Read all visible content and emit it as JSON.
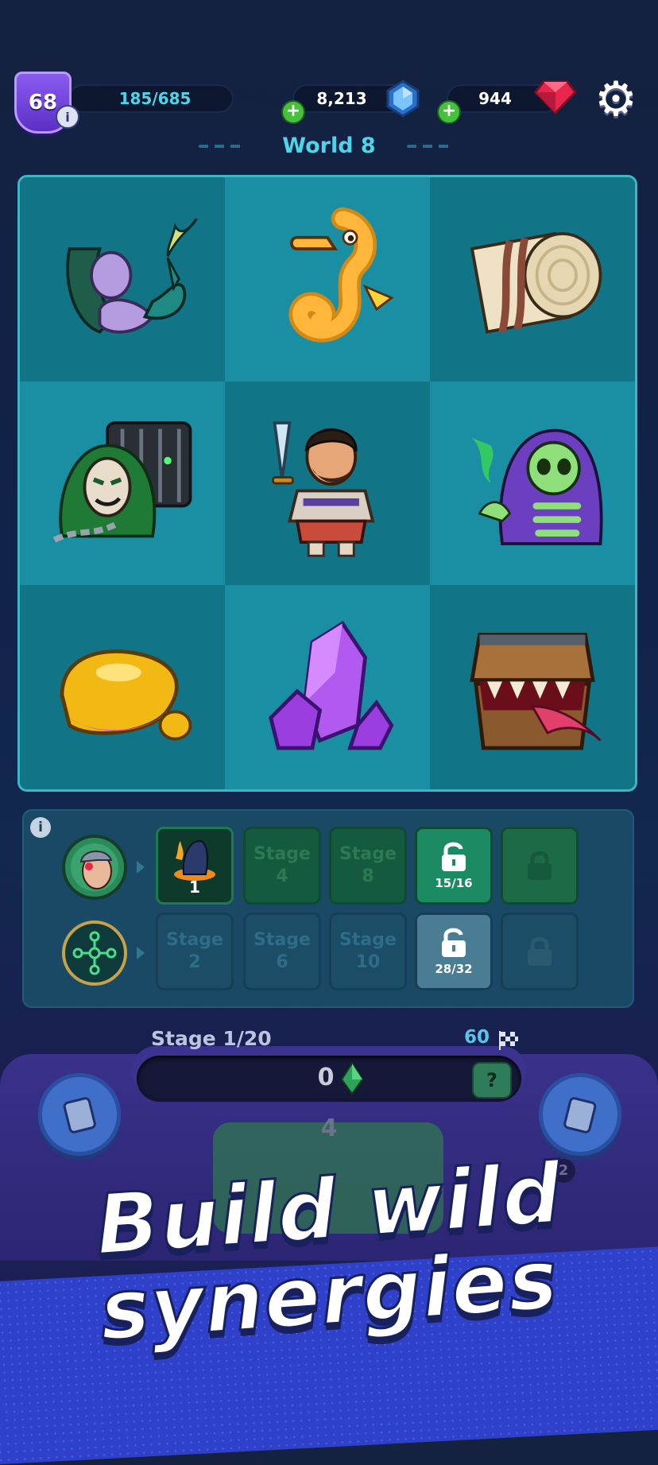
{
  "hud": {
    "level": "68",
    "level_info_icon": "i",
    "xp": "185/685",
    "crystals": "8,213",
    "gems": "944",
    "add_symbol": "+"
  },
  "world": {
    "title": "World 8"
  },
  "grid": {
    "items": [
      {
        "name": "mermaid"
      },
      {
        "name": "seahorse"
      },
      {
        "name": "scroll"
      },
      {
        "name": "caged-masked-wraith"
      },
      {
        "name": "warrior-hero"
      },
      {
        "name": "hooded-skeleton"
      },
      {
        "name": "gold-nugget"
      },
      {
        "name": "purple-crystal"
      },
      {
        "name": "mimic-chest"
      }
    ]
  },
  "lineup": {
    "info_icon": "i",
    "row1": {
      "slots": [
        {
          "type": "active",
          "count": "1"
        },
        {
          "type": "stage",
          "line1": "Stage",
          "line2": "4"
        },
        {
          "type": "stage",
          "line1": "Stage",
          "line2": "8"
        },
        {
          "type": "unlock",
          "progress": "15/16"
        },
        {
          "type": "locked"
        }
      ]
    },
    "row2": {
      "slots": [
        {
          "type": "stage",
          "line1": "Stage",
          "line2": "2"
        },
        {
          "type": "stage",
          "line1": "Stage",
          "line2": "6"
        },
        {
          "type": "stage",
          "line1": "Stage",
          "line2": "10"
        },
        {
          "type": "unlock",
          "progress": "28/32"
        },
        {
          "type": "locked"
        }
      ]
    }
  },
  "stage": {
    "label": "Stage 1/20",
    "count": "60"
  },
  "console": {
    "counter": "0",
    "card_cost": "4",
    "badge": "2"
  },
  "tagline": {
    "line1": "Build wild",
    "line2": "synergies"
  },
  "colors": {
    "accent": "#4ed5ea",
    "board": "#137e91",
    "panel": "#1a4966",
    "gem": "#e8254b",
    "crystal": "#5ba8ee"
  }
}
